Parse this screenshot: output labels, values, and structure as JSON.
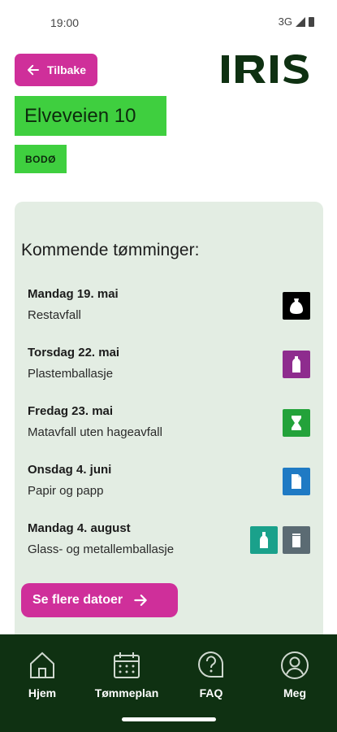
{
  "status_bar": {
    "time": "19:00",
    "network": "3G"
  },
  "header": {
    "back_label": "Tilbake",
    "logo_text": "IRIS",
    "address": "Elveveien 10",
    "city": "BODØ"
  },
  "card": {
    "title": "Kommende tømminger:",
    "pickups": [
      {
        "date": "Mandag 19. mai",
        "type": "Restavfall",
        "icons": [
          {
            "name": "residual-waste-icon",
            "color": "#000000"
          }
        ]
      },
      {
        "date": "Torsdag 22. mai",
        "type": "Plastemballasje",
        "icons": [
          {
            "name": "plastic-bottle-icon",
            "color": "#8e2c8e"
          }
        ]
      },
      {
        "date": "Fredag 23. mai",
        "type": "Matavfall uten hageavfall",
        "icons": [
          {
            "name": "food-waste-icon",
            "color": "#23a23a"
          }
        ]
      },
      {
        "date": "Onsdag 4. juni",
        "type": "Papir og papp",
        "icons": [
          {
            "name": "paper-icon",
            "color": "#1f7ac4"
          }
        ]
      },
      {
        "date": "Mandag 4. august",
        "type": "Glass- og metallemballasje",
        "icons": [
          {
            "name": "glass-bottle-icon",
            "color": "#1aa18b"
          },
          {
            "name": "metal-can-icon",
            "color": "#5b6b73"
          }
        ]
      }
    ],
    "more_label": "Se flere datoer"
  },
  "nav": {
    "items": [
      {
        "label": "Hjem",
        "icon": "home-icon"
      },
      {
        "label": "Tømmeplan",
        "icon": "calendar-icon"
      },
      {
        "label": "FAQ",
        "icon": "faq-icon"
      },
      {
        "label": "Meg",
        "icon": "profile-icon"
      }
    ]
  },
  "colors": {
    "accent": "#cf2f9a",
    "green": "#3fcf3f",
    "nav_bg": "#0f3112",
    "card_bg": "#e3ede3",
    "logo": "#0f3112"
  }
}
